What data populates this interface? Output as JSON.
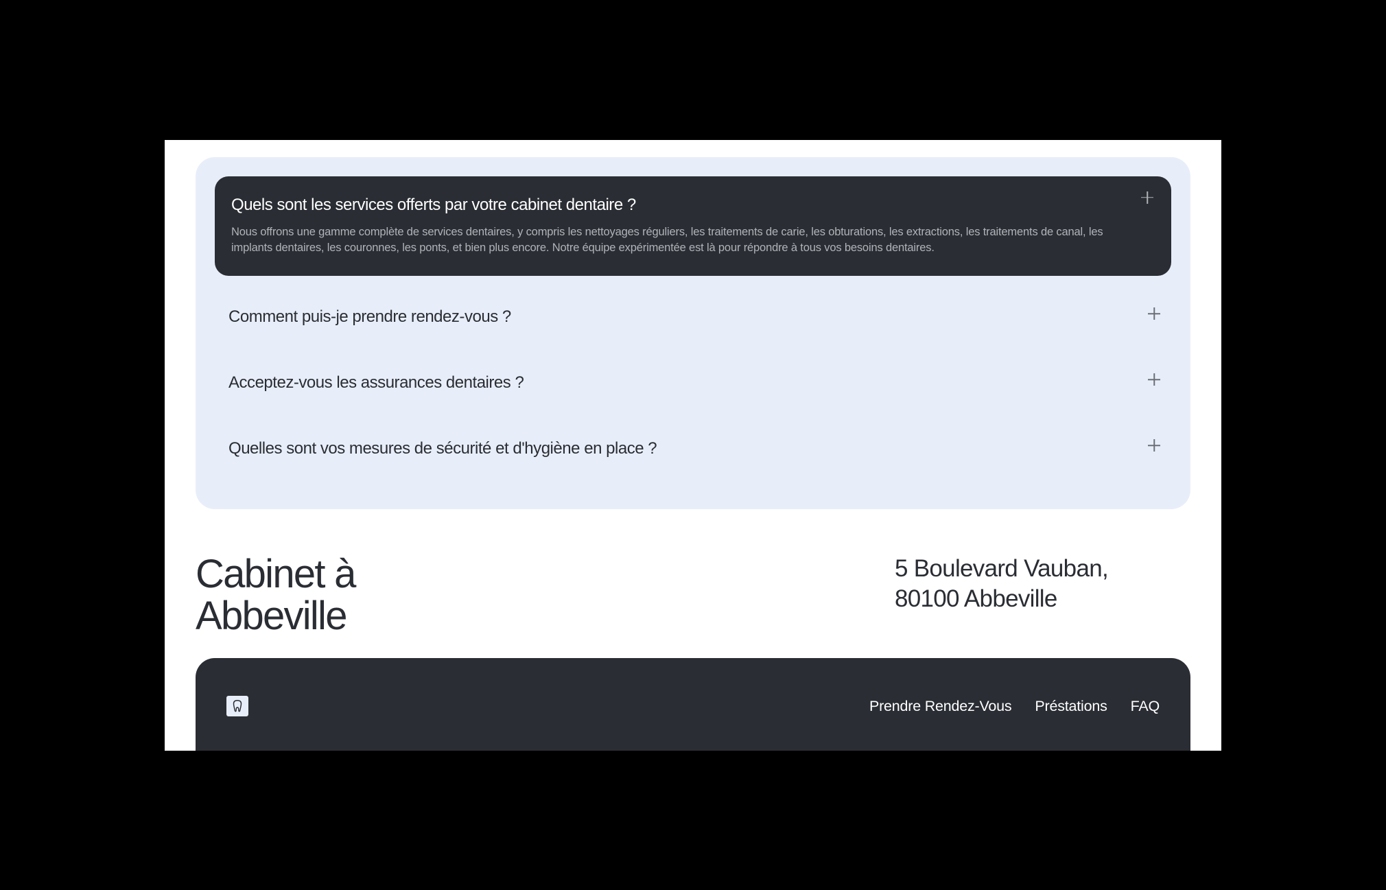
{
  "faq": {
    "items": [
      {
        "question": "Quels sont les services offerts par votre cabinet dentaire ?",
        "answer": "Nous offrons une gamme complète de services dentaires, y compris les nettoyages réguliers, les traitements de carie, les obturations, les extractions, les traitements de canal, les implants dentaires, les couronnes, les ponts, et bien plus encore. Notre équipe expérimentée est là pour répondre à tous vos besoins dentaires.",
        "expanded": true
      },
      {
        "question": "Comment puis-je prendre rendez-vous ?",
        "expanded": false
      },
      {
        "question": "Acceptez-vous les assurances dentaires ?",
        "expanded": false
      },
      {
        "question": "Quelles sont vos mesures de sécurité et d'hygiène en place ?",
        "expanded": false
      }
    ]
  },
  "location": {
    "title_line1": "Cabinet à",
    "title_line2": "Abbeville",
    "address_line1": "5 Boulevard Vauban,",
    "address_line2": "80100 Abbeville"
  },
  "footer": {
    "links": [
      {
        "label": "Prendre Rendez-Vous"
      },
      {
        "label": "Préstations"
      },
      {
        "label": "FAQ"
      }
    ]
  }
}
